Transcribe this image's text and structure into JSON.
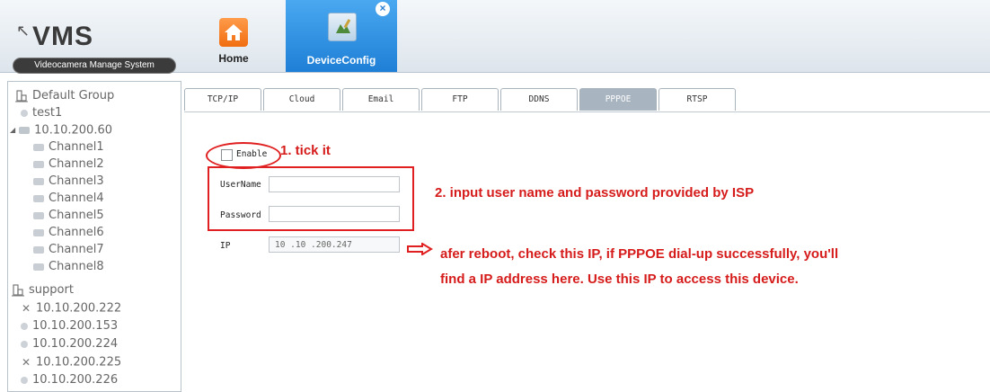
{
  "app": {
    "logo_cursor": "↖",
    "logo_title": "VMS",
    "logo_subtitle": "Videocamera Manage System"
  },
  "nav": {
    "home_label": "Home",
    "deviceconfig_label": "DeviceConfig",
    "close_glyph": "×"
  },
  "sidebar": {
    "items": [
      {
        "label": "Default Group",
        "icon": "group-icon"
      },
      {
        "label": "test1",
        "icon": "device-icon"
      },
      {
        "label": "10.10.200.60",
        "icon": "camera-icon",
        "expanded": true
      },
      {
        "label": "Channel1",
        "icon": "channel-icon"
      },
      {
        "label": "Channel2",
        "icon": "channel-icon"
      },
      {
        "label": "Channel3",
        "icon": "channel-icon"
      },
      {
        "label": "Channel4",
        "icon": "channel-icon"
      },
      {
        "label": "Channel5",
        "icon": "channel-icon"
      },
      {
        "label": "Channel6",
        "icon": "channel-icon"
      },
      {
        "label": "Channel7",
        "icon": "channel-icon"
      },
      {
        "label": "Channel8",
        "icon": "channel-icon"
      },
      {
        "label": "support",
        "icon": "group-icon"
      },
      {
        "label": "10.10.200.222",
        "icon": "offline-icon"
      },
      {
        "label": "10.10.200.153",
        "icon": "device-icon"
      },
      {
        "label": "10.10.200.224",
        "icon": "device-icon"
      },
      {
        "label": "10.10.200.225",
        "icon": "offline-icon"
      },
      {
        "label": "10.10.200.226",
        "icon": "device-icon"
      }
    ]
  },
  "tabs": [
    {
      "label": "TCP/IP",
      "active": false
    },
    {
      "label": "Cloud",
      "active": false
    },
    {
      "label": "Email",
      "active": false
    },
    {
      "label": "FTP",
      "active": false
    },
    {
      "label": "DDNS",
      "active": false
    },
    {
      "label": "PPPOE",
      "active": true
    },
    {
      "label": "RTSP",
      "active": false
    }
  ],
  "form": {
    "enable_label": "Enable",
    "enable_checked": false,
    "username_label": "UserName",
    "username_value": "",
    "password_label": "Password",
    "password_value": "",
    "ip_label": "IP",
    "ip_value": "10 .10 .200.247"
  },
  "annotations": {
    "step1": "1. tick it",
    "step2": "2. input user name and password provided by ISP",
    "step3_line1": "afer reboot, check this IP, if PPPOE dial-up successfully, you'll",
    "step3_line2": "find a IP address here. Use this IP to access this device.",
    "color": "#d61b1b"
  },
  "colors": {
    "accent": "#1e7fd6",
    "active_tab": "#a8b4c0",
    "annotation_red": "#e02020"
  }
}
